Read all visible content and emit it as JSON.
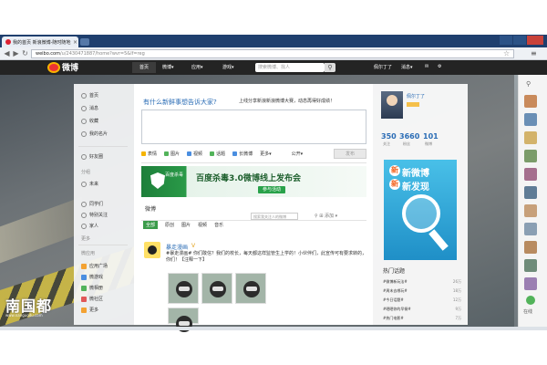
{
  "browser": {
    "tab_title": "我的首页 新浪微博-随时随地分享身边",
    "tab_close": "×",
    "url_host": "weibo.com",
    "url_path": "/u/2430471887/home?wvr=5&lf=reg",
    "back": "◀",
    "forward": "▶",
    "reload": "↻",
    "star": "☆",
    "menu": "≡"
  },
  "topnav": {
    "logo_text": "微博",
    "home": "首页",
    "items": [
      "微博▾",
      "应用▾",
      "游戏▾"
    ],
    "search_placeholder": "搜索微博、找人",
    "search_icon": "⚲",
    "right_items": [
      "佩尔丁了",
      "消息▾",
      "✉",
      "⚙"
    ]
  },
  "left_nav": {
    "items": [
      {
        "label": "首页"
      },
      {
        "label": "消息"
      },
      {
        "label": "收藏"
      },
      {
        "label": "我的名片"
      }
    ],
    "group1": [
      {
        "label": "好友圈"
      }
    ],
    "section_head": "分组",
    "group2": [
      {
        "label": "未来"
      },
      {
        "label": "同学们"
      },
      {
        "label": "特别关注"
      },
      {
        "label": "家人"
      }
    ],
    "more": "更多",
    "section_head2": "微应用",
    "apps": [
      {
        "label": "应用广场"
      },
      {
        "label": "微游戏"
      },
      {
        "label": "微相册"
      },
      {
        "label": "微社区"
      },
      {
        "label": "更多"
      }
    ]
  },
  "compose": {
    "question": "有什么新鲜事想告诉大家?",
    "hot": "上线分享新浪新浪微博大赛，动态再得好成绩！",
    "tools": [
      "表情",
      "图片",
      "视频",
      "话题",
      "长微博",
      "更多▾"
    ],
    "visibility": "公开▾",
    "publish": "发布"
  },
  "banner": {
    "brand": "百度杀毒",
    "headline": "百度杀毒3.0微博线上发布会",
    "cta": "参与活动"
  },
  "feed": {
    "label": "微博",
    "filter_placeholder": "搜索我关注人的微博",
    "right": "⚲  ⊞ 添加  ▾",
    "tabs": [
      "全部",
      "原创",
      "图片",
      "视频",
      "音乐"
    ],
    "post": {
      "user": "暴走漫画",
      "verified": "V",
      "text": "#暴走漫画# 你们敢信？我们的校长，每天都这样监管生上学的！小伙伴们，此宣传可有要求转的，你们！【注释一下】",
      "thumbs": [
        "图1",
        "图2",
        "图3",
        "图4"
      ]
    }
  },
  "profile": {
    "name": "佩尔丁了",
    "stats": [
      {
        "num": "350",
        "label": "关注"
      },
      {
        "num": "3660",
        "label": "粉丝"
      },
      {
        "num": "101",
        "label": "微博"
      }
    ]
  },
  "ad": {
    "line1": "新微博",
    "line2": "新发现",
    "char1": "新",
    "char2": "新"
  },
  "ranking": {
    "head": "热门话题",
    "rows": [
      {
        "t": "#微博新玩法#",
        "c": "26万"
      },
      {
        "t": "#周末去哪玩#",
        "c": "18万"
      },
      {
        "t": "#今日话题#",
        "c": "12万"
      },
      {
        "t": "#晒晒你的早餐#",
        "c": "9万"
      },
      {
        "t": "#热门电影#",
        "c": "7万"
      }
    ]
  },
  "rail": {
    "search": "⚲",
    "label": "在线"
  },
  "watermark": {
    "main": "南国都",
    "sub": "www.nanguodu.com"
  },
  "colors": {
    "link": "#2a6cb5",
    "nav_bg": "#242424",
    "green": "#29a24a"
  }
}
